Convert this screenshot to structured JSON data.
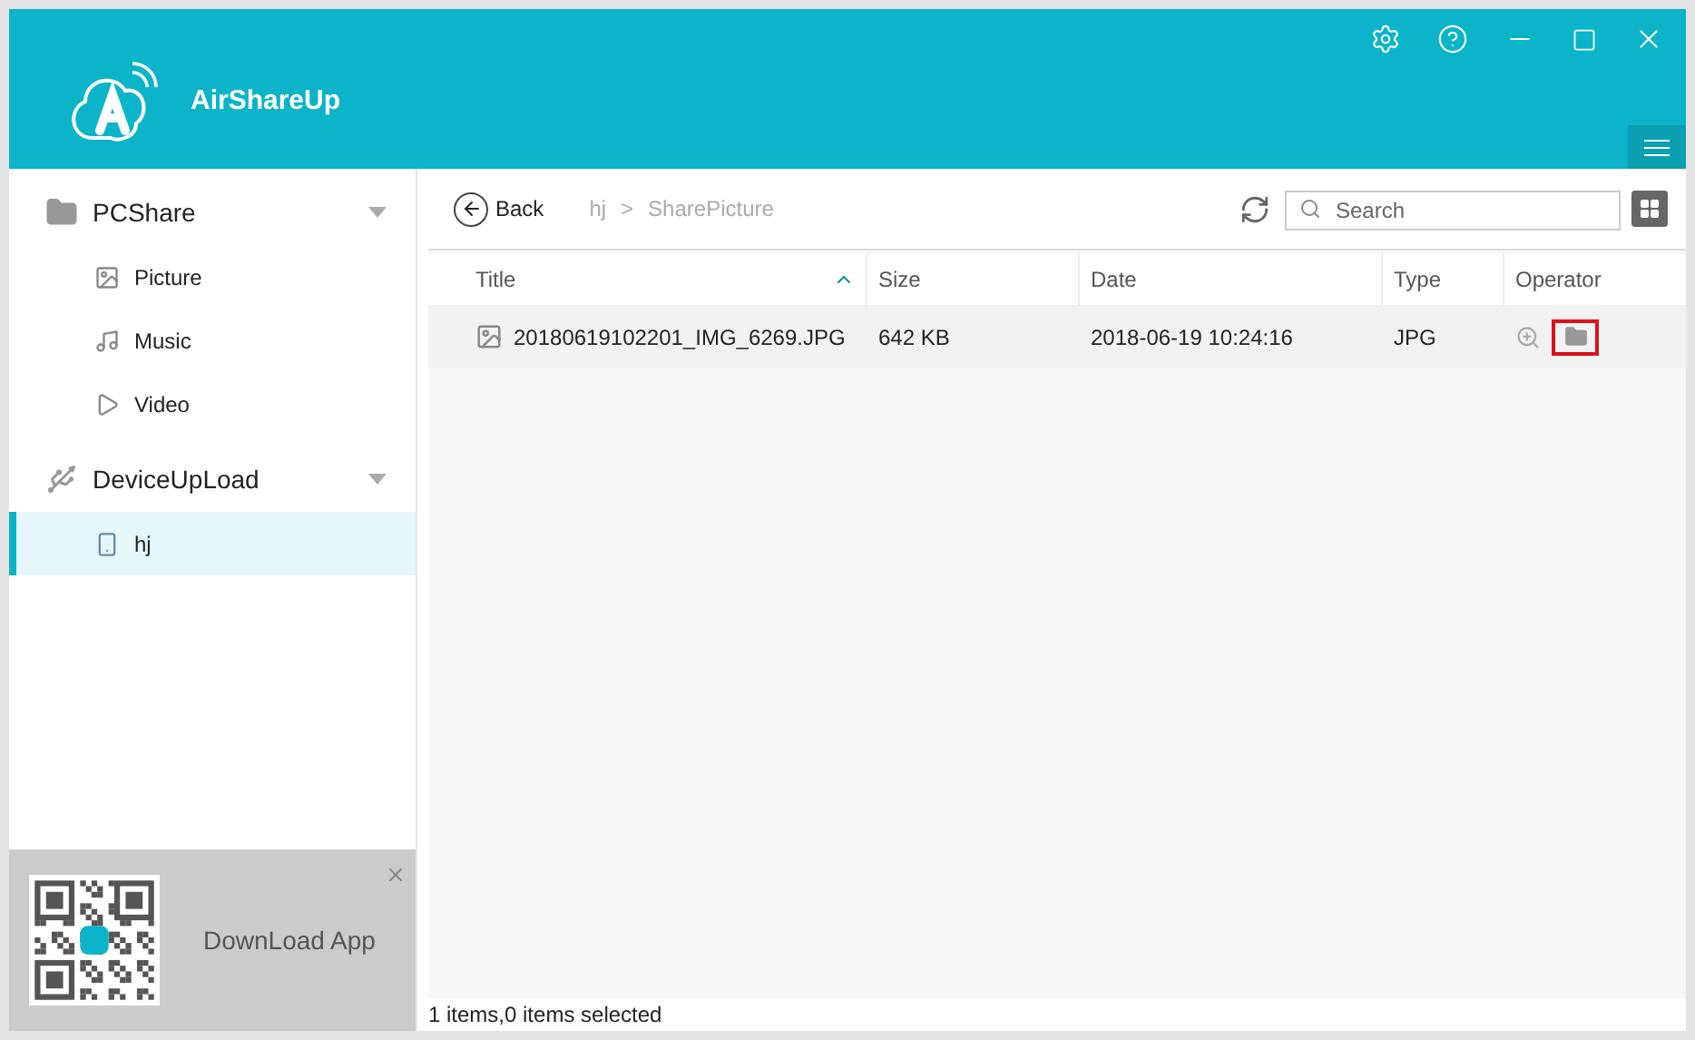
{
  "app": {
    "title": "AirShareUp"
  },
  "sidebar": {
    "groups": [
      {
        "label": "PCShare",
        "kind": "folder",
        "expanded": true,
        "children": [
          {
            "label": "Picture",
            "kind": "picture",
            "selected": false
          },
          {
            "label": "Music",
            "kind": "music",
            "selected": false
          },
          {
            "label": "Video",
            "kind": "video",
            "selected": false
          }
        ]
      },
      {
        "label": "DeviceUpLoad",
        "kind": "usb",
        "expanded": true,
        "children": [
          {
            "label": "hj",
            "kind": "phone",
            "selected": true
          }
        ]
      }
    ]
  },
  "promo": {
    "label": "DownLoad App"
  },
  "toolbar": {
    "back": "Back",
    "breadcrumb": [
      "hj",
      "SharePicture"
    ],
    "separator": ">",
    "search": {
      "placeholder": "Search"
    }
  },
  "table": {
    "columns": [
      {
        "label": "Title",
        "sorted": true
      },
      {
        "label": "Size",
        "sorted": false
      },
      {
        "label": "Date",
        "sorted": false
      },
      {
        "label": "Type",
        "sorted": false
      },
      {
        "label": "Operator",
        "sorted": false
      }
    ],
    "rows": [
      {
        "title": "20180619102201_IMG_6269.JPG",
        "size": "642 KB",
        "date": "2018-06-19 10:24:16",
        "type": "JPG",
        "highlighted_action": true
      }
    ]
  },
  "status_bar": "1 items,0 items selected"
}
